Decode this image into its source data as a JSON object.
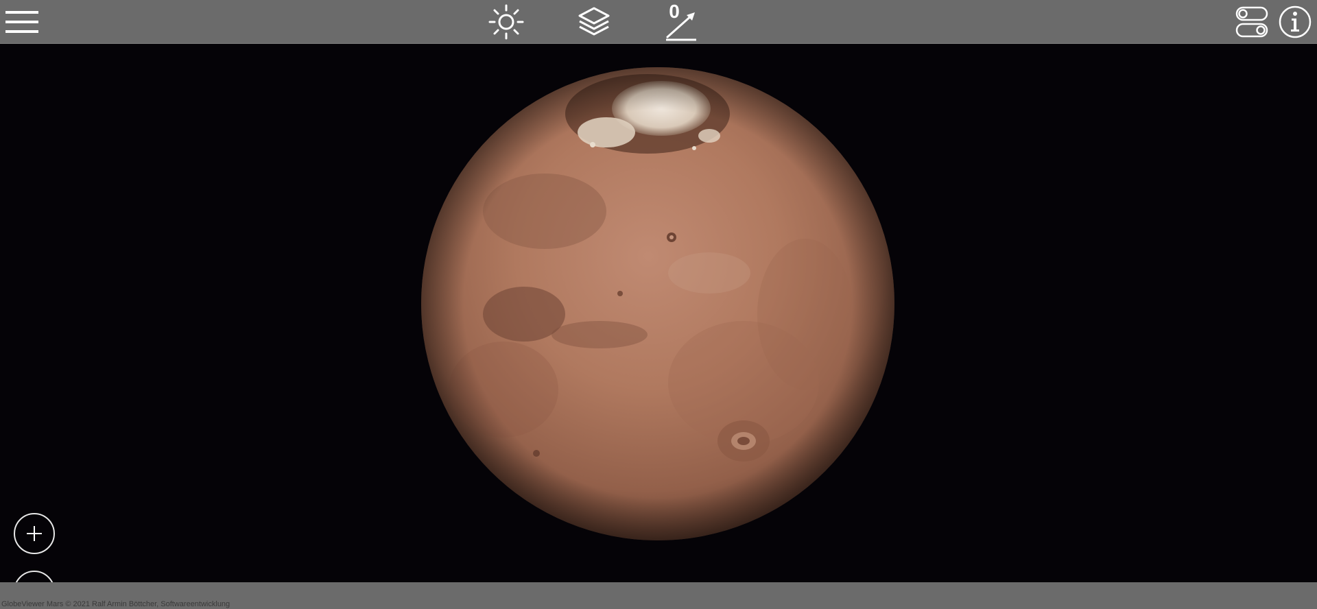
{
  "toolbar": {
    "menu_icon": "hamburger-menu-icon",
    "sun_icon": "sun-lighting-icon",
    "layers_icon": "layers-icon",
    "measure_icon": "distance-measure-icon",
    "measure_count": "0",
    "settings_icon": "toggle-settings-icon",
    "info_icon": "info-icon"
  },
  "viewport": {
    "globe": "Mars"
  },
  "zoom": {
    "zoom_in_icon": "plus-icon",
    "zoom_out_icon": "minus-icon"
  },
  "footer": {
    "copyright": "GlobeViewer Mars © 2021 Ralf Armin Böttcher, Softwareentwicklung"
  },
  "colors": {
    "toolbar_bg": "#6b6b6b",
    "space_bg": "#050307",
    "icon_color": "#ffffff",
    "mars_surface": "#b07a62"
  }
}
